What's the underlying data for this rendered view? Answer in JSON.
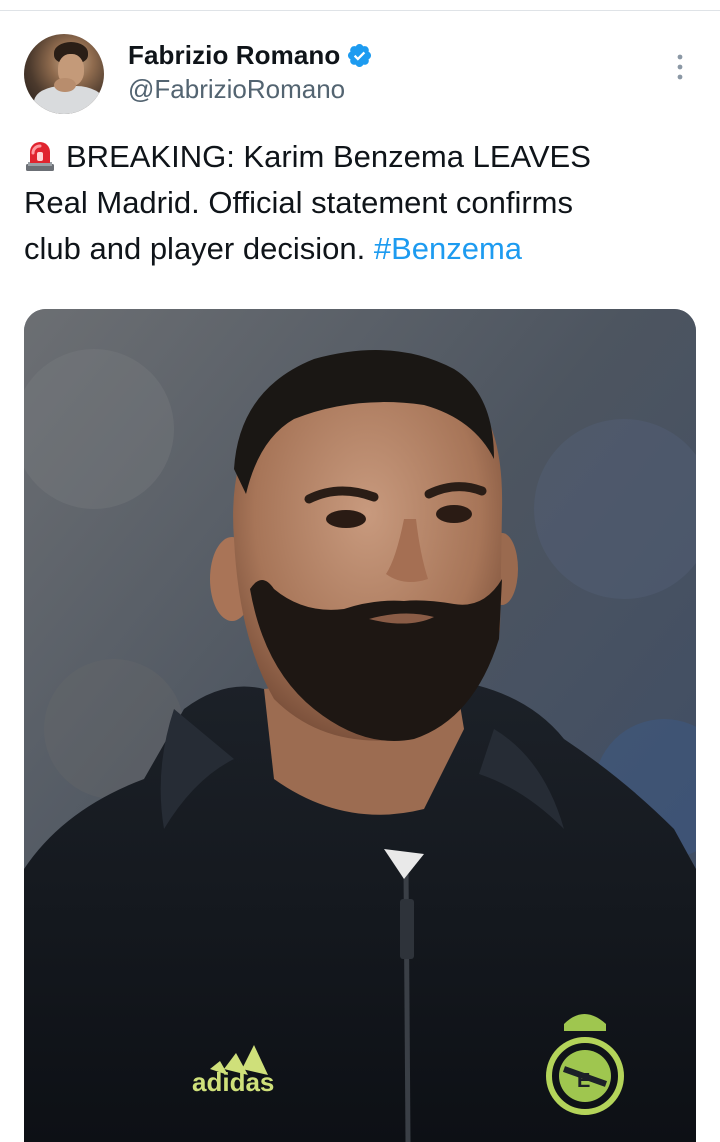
{
  "author": {
    "display_name": "Fabrizio Romano",
    "handle": "@FabrizioRomano",
    "verified": true,
    "avatar_icon": "profile-photo"
  },
  "tweet": {
    "emoji": "police-car-light-emoji",
    "lines": [
      "BREAKING: Karim Benzema LEAVES",
      "Real Madrid. Official statement confirms",
      "club and player decision."
    ],
    "hashtag": "#Benzema"
  },
  "media": {
    "type": "photo",
    "brand_logo_text": "adidas",
    "crest": "real-madrid-crest"
  },
  "colors": {
    "text": "#0f1419",
    "secondary": "#536471",
    "accent": "#1d9bf0"
  },
  "icons": {
    "more": "more-vertical-icon",
    "verified": "verified-badge-icon"
  }
}
